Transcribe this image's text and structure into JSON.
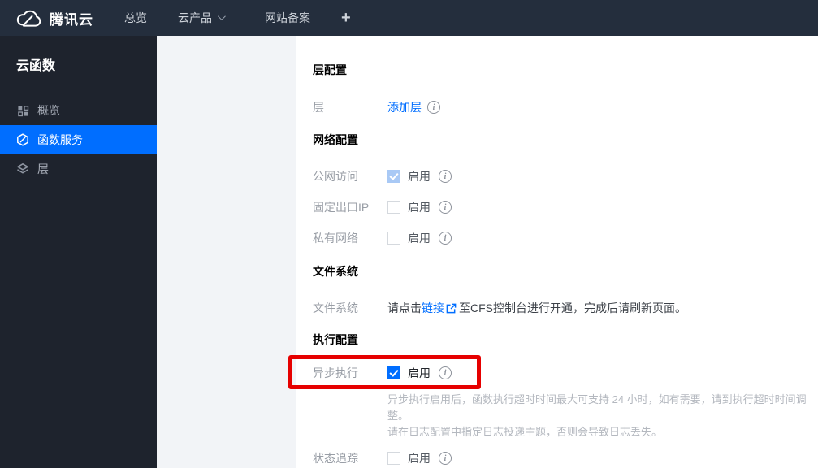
{
  "topbar": {
    "brand": "腾讯云",
    "nav": [
      {
        "label": "总览"
      },
      {
        "label": "云产品"
      },
      {
        "label": "网站备案"
      }
    ],
    "plus": "+"
  },
  "sidebar": {
    "title": "云函数",
    "items": [
      {
        "label": "概览",
        "icon": "grid-icon",
        "active": false
      },
      {
        "label": "函数服务",
        "icon": "function-icon",
        "active": true
      },
      {
        "label": "层",
        "icon": "layers-icon",
        "active": false
      }
    ]
  },
  "main": {
    "layer_section": {
      "title": "层配置",
      "row": {
        "label": "层",
        "link": "添加层"
      }
    },
    "network_section": {
      "title": "网络配置",
      "rows": [
        {
          "label": "公网访问",
          "toggle": "启用",
          "state": "checked-disabled"
        },
        {
          "label": "固定出口IP",
          "toggle": "启用",
          "state": "unchecked"
        },
        {
          "label": "私有网络",
          "toggle": "启用",
          "state": "unchecked"
        }
      ]
    },
    "filesystem_section": {
      "title": "文件系统",
      "row": {
        "label": "文件系统",
        "text_before": "请点击",
        "link": "链接",
        "text_after": "至CFS控制台进行开通，完成后请刷新页面。"
      }
    },
    "execution_section": {
      "title": "执行配置",
      "async_row": {
        "label": "异步执行",
        "toggle": "启用",
        "state": "checked"
      },
      "helper_line1": "异步执行启用后，函数执行超时时间最大可支持 24 小时，如有需要，请到执行超时时间调整。",
      "helper_line2": "请在日志配置中指定日志投递主题，否则会导致日志丢失。",
      "trace_row": {
        "label": "状态追踪",
        "toggle": "启用",
        "state": "unchecked"
      }
    }
  },
  "colors": {
    "accent_blue": "#006eff",
    "annotation_red": "#e60000",
    "topbar_bg": "#242e3d",
    "sidebar_bg": "#1e232d",
    "panel_bg": "#f2f4f7",
    "disabled_checked": "#a9c9f5"
  }
}
